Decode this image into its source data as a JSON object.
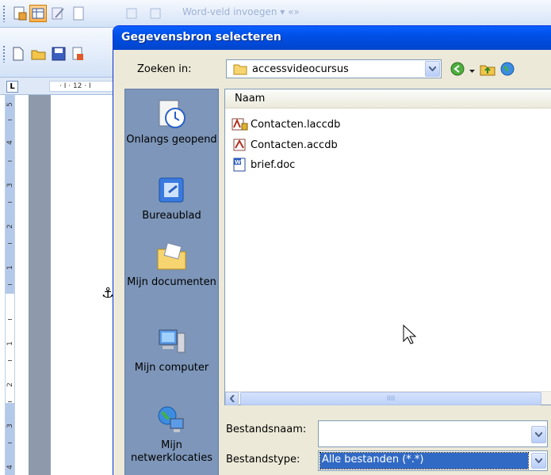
{
  "toolbar": {
    "faint_text": "Word-veld invoegen ▾  «»",
    "ruler_text": "· I · 12 · I"
  },
  "ruler": {
    "corner_label": "L",
    "vertical_numbers": [
      "5",
      "4",
      "3",
      "2",
      "1",
      "1",
      "2",
      "3",
      "4"
    ]
  },
  "dialog": {
    "title": "Gegevensbron selecteren",
    "look_in_label": "Zoeken in:",
    "look_in_value": "accessvideocursus",
    "places": [
      {
        "label": "Onlangs geopend",
        "icon": "recent-icon"
      },
      {
        "label": "Bureaublad",
        "icon": "desktop-icon"
      },
      {
        "label": "Mijn documenten",
        "icon": "my-documents-icon"
      },
      {
        "label": "Mijn computer",
        "icon": "my-computer-icon"
      },
      {
        "label": "Mijn netwerklocaties",
        "icon": "network-icon"
      }
    ],
    "column_header": "Naam",
    "files": [
      {
        "name": "Contacten.laccdb",
        "icon": "access-lock-icon"
      },
      {
        "name": "Contacten.accdb",
        "icon": "access-db-icon"
      },
      {
        "name": "brief.doc",
        "icon": "word-doc-icon"
      }
    ],
    "filename_label": "Bestandsnaam:",
    "filename_value": "",
    "filetype_label": "Bestandstype:",
    "filetype_value": "Alle bestanden (*.*)",
    "scroll_grip": "IIII"
  }
}
